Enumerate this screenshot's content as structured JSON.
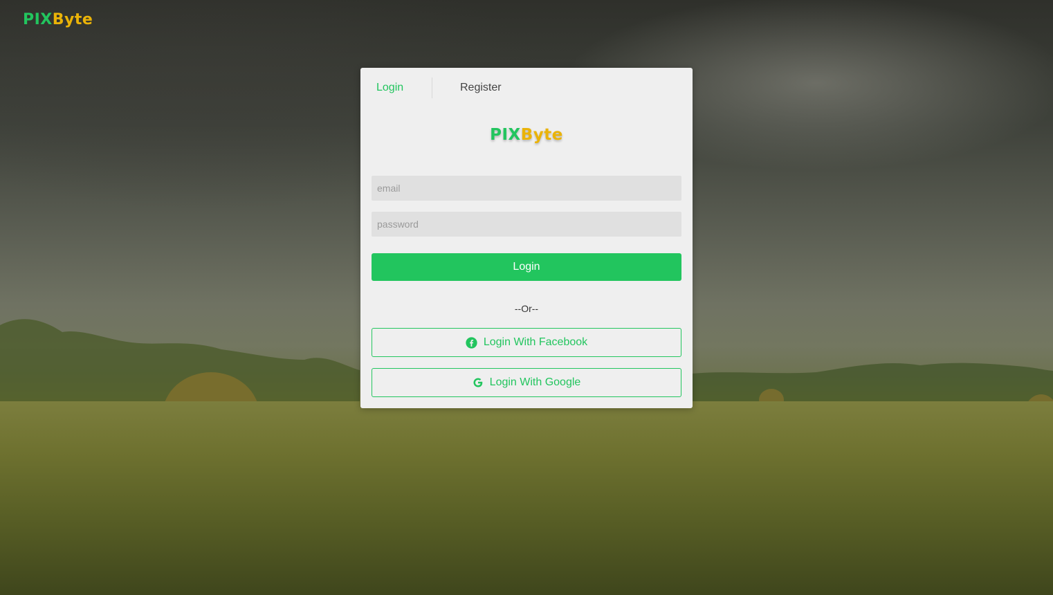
{
  "header": {
    "logo_pix": "PIX",
    "logo_byte": "Byte"
  },
  "card": {
    "tabs": [
      {
        "label": "Login",
        "active": true
      },
      {
        "label": "Register",
        "active": false
      }
    ],
    "logo_pix": "PIX",
    "logo_byte": "Byte",
    "email": {
      "placeholder": "email",
      "value": ""
    },
    "password": {
      "placeholder": "password",
      "value": ""
    },
    "login_button": "Login",
    "separator": "--Or--",
    "facebook_button": "Login With Facebook",
    "google_button": "Login With Google"
  },
  "colors": {
    "accent_green": "#22c55e",
    "brand_yellow": "#eab308",
    "card_background": "#efefef",
    "input_background": "#e0e0e0"
  },
  "icons": {
    "facebook": "facebook-icon",
    "google": "google-icon"
  }
}
